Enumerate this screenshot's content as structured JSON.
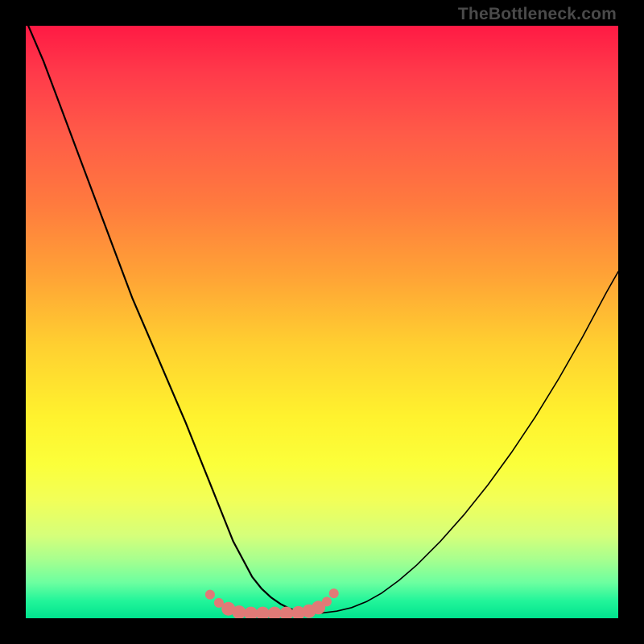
{
  "watermark_text": "TheBottleneck.com",
  "chart_data": {
    "type": "line",
    "title": "",
    "xlabel": "",
    "ylabel": "",
    "xlim": [
      0,
      100
    ],
    "ylim": [
      0,
      100
    ],
    "grid": false,
    "legend": false,
    "series": [
      {
        "name": "bottleneck-curve",
        "color": "#000000",
        "x": [
          0,
          3,
          6,
          9,
          12,
          15,
          18,
          21,
          24,
          27,
          29,
          31,
          33,
          35,
          36.6,
          38.2,
          39.8,
          41.4,
          43,
          44.6,
          46.2,
          47.5,
          50,
          52.5,
          55,
          57.5,
          60,
          63,
          66,
          70,
          74,
          78,
          82,
          86,
          90,
          94,
          98,
          100
        ],
        "y": [
          101,
          94,
          86,
          78,
          70,
          62,
          54,
          47,
          40,
          33,
          28,
          23,
          18,
          13,
          10,
          7,
          5,
          3.5,
          2.4,
          1.6,
          1.1,
          0.9,
          0.9,
          1.2,
          1.8,
          2.8,
          4.2,
          6.4,
          9,
          13,
          17.5,
          22.5,
          28,
          34,
          40.5,
          47.5,
          55,
          58.5
        ]
      },
      {
        "name": "marker-cluster",
        "color": "#e07a77",
        "x": [
          31.1,
          32.6,
          34.2,
          36.0,
          38.0,
          40.0,
          42.0,
          44.0,
          46.0,
          47.8,
          49.4,
          50.8,
          52.0
        ],
        "y": [
          4.0,
          2.6,
          1.6,
          1.0,
          0.8,
          0.8,
          0.8,
          0.8,
          0.9,
          1.2,
          1.8,
          2.8,
          4.2
        ]
      }
    ],
    "note": "Values are approximate, read from pixel positions; x and y are in percent of plot area (0 at left/bottom, 100 at right/top)."
  }
}
